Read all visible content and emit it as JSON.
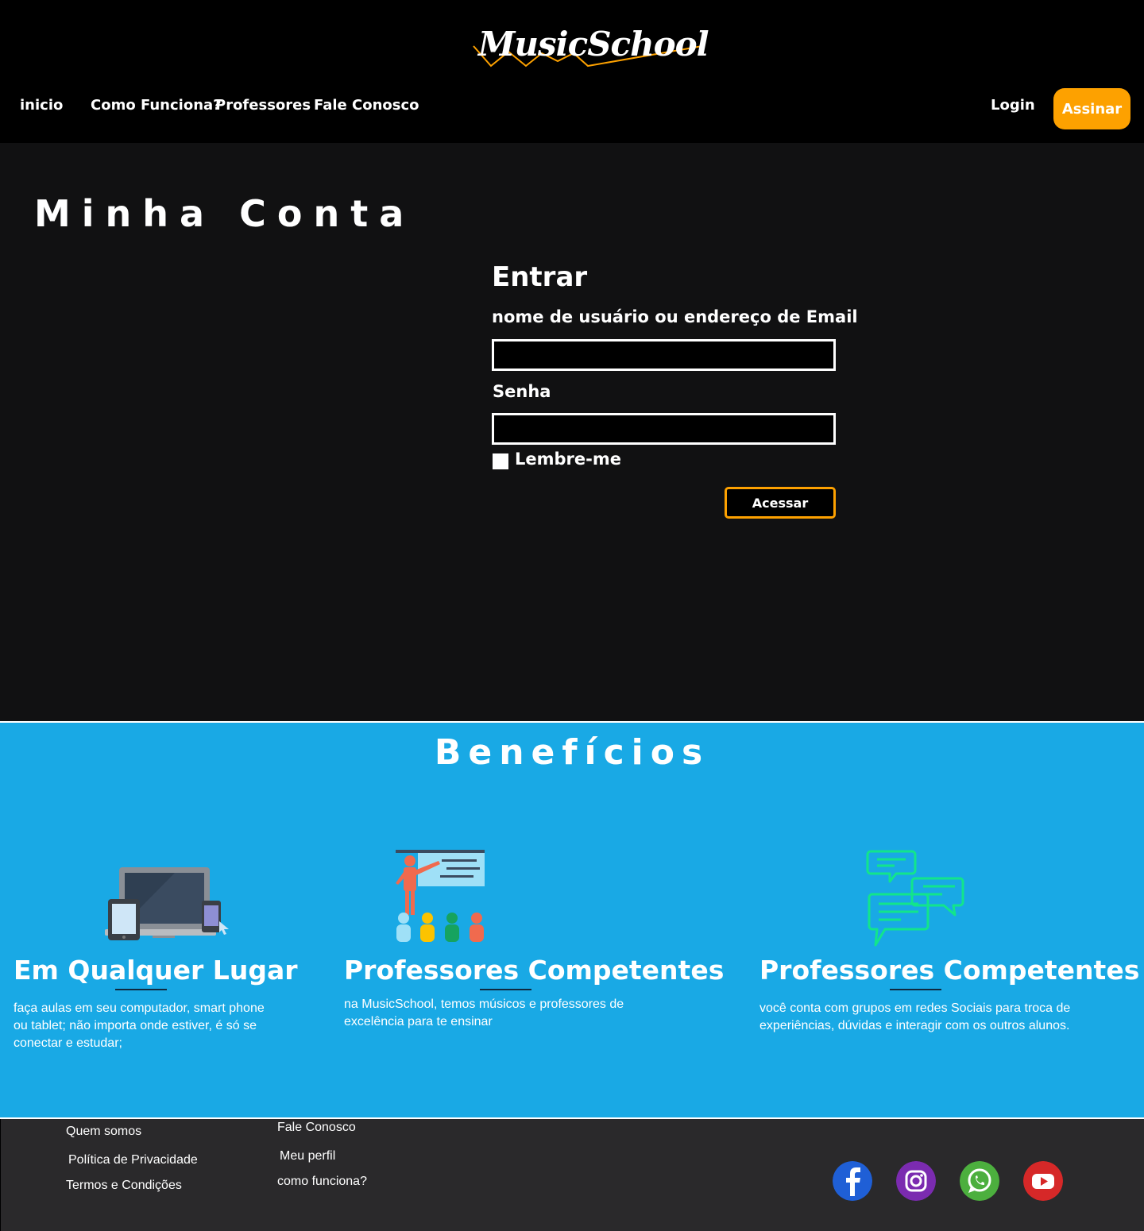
{
  "header": {
    "logo_text": "MusicSchool",
    "nav": [
      "inicio",
      "Como Funciona?",
      "Professores",
      "Fale Conosco"
    ],
    "login_label": "Login",
    "subscribe_label": "Assinar"
  },
  "main": {
    "page_title": "Minha Conta",
    "form": {
      "title": "Entrar",
      "username_label": "nome de usuário ou endereço de  Email",
      "username_value": "",
      "password_label": "Senha",
      "password_value": "",
      "remember_label": "Lembre-me",
      "remember_checked": false,
      "submit_label": "Acessar"
    }
  },
  "benefits": {
    "title": "Benefícios",
    "items": [
      {
        "icon": "devices-icon",
        "heading": "Em Qualquer Lugar",
        "text": "faça aulas em seu computador, smart phone ou tablet; não importa onde estiver, é só se conectar e estudar;"
      },
      {
        "icon": "teacher-presentation-icon",
        "heading": "Professores Competentes",
        "text": "na MusicSchool, temos músicos e professores de excelência para te ensinar"
      },
      {
        "icon": "chat-bubbles-icon",
        "heading": "Professores Competentes",
        "text": "você conta com grupos em redes Sociais para troca de experiências, dúvidas e interagir com os outros alunos."
      }
    ]
  },
  "footer": {
    "col1": [
      "Quem somos",
      "Política de Privacidade",
      "Termos e Condições"
    ],
    "col2": [
      "Fale Conosco",
      "Meu perfil",
      "como funciona?"
    ],
    "social": [
      "facebook-icon",
      "instagram-icon",
      "whatsapp-icon",
      "youtube-icon"
    ]
  },
  "colors": {
    "accent": "#fda100",
    "benefits_bg": "#19a9e5",
    "main_bg": "#111112",
    "footer_bg": "#2a292b"
  }
}
